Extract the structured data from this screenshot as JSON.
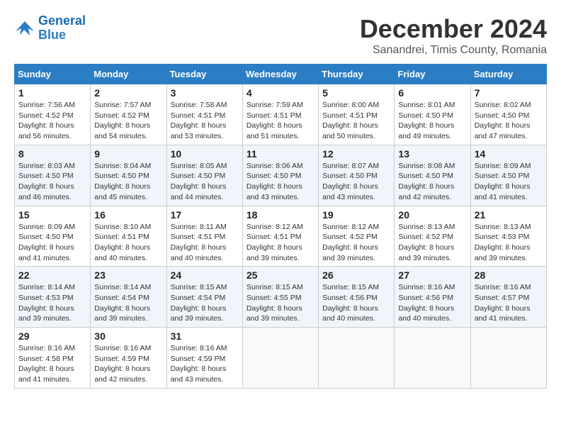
{
  "logo": {
    "line1": "General",
    "line2": "Blue"
  },
  "title": "December 2024",
  "subtitle": "Sanandrei, Timis County, Romania",
  "days_header": [
    "Sunday",
    "Monday",
    "Tuesday",
    "Wednesday",
    "Thursday",
    "Friday",
    "Saturday"
  ],
  "weeks": [
    [
      {
        "day": "1",
        "sunrise": "Sunrise: 7:56 AM",
        "sunset": "Sunset: 4:52 PM",
        "daylight": "Daylight: 8 hours and 56 minutes."
      },
      {
        "day": "2",
        "sunrise": "Sunrise: 7:57 AM",
        "sunset": "Sunset: 4:52 PM",
        "daylight": "Daylight: 8 hours and 54 minutes."
      },
      {
        "day": "3",
        "sunrise": "Sunrise: 7:58 AM",
        "sunset": "Sunset: 4:51 PM",
        "daylight": "Daylight: 8 hours and 53 minutes."
      },
      {
        "day": "4",
        "sunrise": "Sunrise: 7:59 AM",
        "sunset": "Sunset: 4:51 PM",
        "daylight": "Daylight: 8 hours and 51 minutes."
      },
      {
        "day": "5",
        "sunrise": "Sunrise: 8:00 AM",
        "sunset": "Sunset: 4:51 PM",
        "daylight": "Daylight: 8 hours and 50 minutes."
      },
      {
        "day": "6",
        "sunrise": "Sunrise: 8:01 AM",
        "sunset": "Sunset: 4:50 PM",
        "daylight": "Daylight: 8 hours and 49 minutes."
      },
      {
        "day": "7",
        "sunrise": "Sunrise: 8:02 AM",
        "sunset": "Sunset: 4:50 PM",
        "daylight": "Daylight: 8 hours and 47 minutes."
      }
    ],
    [
      {
        "day": "8",
        "sunrise": "Sunrise: 8:03 AM",
        "sunset": "Sunset: 4:50 PM",
        "daylight": "Daylight: 8 hours and 46 minutes."
      },
      {
        "day": "9",
        "sunrise": "Sunrise: 8:04 AM",
        "sunset": "Sunset: 4:50 PM",
        "daylight": "Daylight: 8 hours and 45 minutes."
      },
      {
        "day": "10",
        "sunrise": "Sunrise: 8:05 AM",
        "sunset": "Sunset: 4:50 PM",
        "daylight": "Daylight: 8 hours and 44 minutes."
      },
      {
        "day": "11",
        "sunrise": "Sunrise: 8:06 AM",
        "sunset": "Sunset: 4:50 PM",
        "daylight": "Daylight: 8 hours and 43 minutes."
      },
      {
        "day": "12",
        "sunrise": "Sunrise: 8:07 AM",
        "sunset": "Sunset: 4:50 PM",
        "daylight": "Daylight: 8 hours and 43 minutes."
      },
      {
        "day": "13",
        "sunrise": "Sunrise: 8:08 AM",
        "sunset": "Sunset: 4:50 PM",
        "daylight": "Daylight: 8 hours and 42 minutes."
      },
      {
        "day": "14",
        "sunrise": "Sunrise: 8:09 AM",
        "sunset": "Sunset: 4:50 PM",
        "daylight": "Daylight: 8 hours and 41 minutes."
      }
    ],
    [
      {
        "day": "15",
        "sunrise": "Sunrise: 8:09 AM",
        "sunset": "Sunset: 4:50 PM",
        "daylight": "Daylight: 8 hours and 41 minutes."
      },
      {
        "day": "16",
        "sunrise": "Sunrise: 8:10 AM",
        "sunset": "Sunset: 4:51 PM",
        "daylight": "Daylight: 8 hours and 40 minutes."
      },
      {
        "day": "17",
        "sunrise": "Sunrise: 8:11 AM",
        "sunset": "Sunset: 4:51 PM",
        "daylight": "Daylight: 8 hours and 40 minutes."
      },
      {
        "day": "18",
        "sunrise": "Sunrise: 8:12 AM",
        "sunset": "Sunset: 4:51 PM",
        "daylight": "Daylight: 8 hours and 39 minutes."
      },
      {
        "day": "19",
        "sunrise": "Sunrise: 8:12 AM",
        "sunset": "Sunset: 4:52 PM",
        "daylight": "Daylight: 8 hours and 39 minutes."
      },
      {
        "day": "20",
        "sunrise": "Sunrise: 8:13 AM",
        "sunset": "Sunset: 4:52 PM",
        "daylight": "Daylight: 8 hours and 39 minutes."
      },
      {
        "day": "21",
        "sunrise": "Sunrise: 8:13 AM",
        "sunset": "Sunset: 4:53 PM",
        "daylight": "Daylight: 8 hours and 39 minutes."
      }
    ],
    [
      {
        "day": "22",
        "sunrise": "Sunrise: 8:14 AM",
        "sunset": "Sunset: 4:53 PM",
        "daylight": "Daylight: 8 hours and 39 minutes."
      },
      {
        "day": "23",
        "sunrise": "Sunrise: 8:14 AM",
        "sunset": "Sunset: 4:54 PM",
        "daylight": "Daylight: 8 hours and 39 minutes."
      },
      {
        "day": "24",
        "sunrise": "Sunrise: 8:15 AM",
        "sunset": "Sunset: 4:54 PM",
        "daylight": "Daylight: 8 hours and 39 minutes."
      },
      {
        "day": "25",
        "sunrise": "Sunrise: 8:15 AM",
        "sunset": "Sunset: 4:55 PM",
        "daylight": "Daylight: 8 hours and 39 minutes."
      },
      {
        "day": "26",
        "sunrise": "Sunrise: 8:15 AM",
        "sunset": "Sunset: 4:56 PM",
        "daylight": "Daylight: 8 hours and 40 minutes."
      },
      {
        "day": "27",
        "sunrise": "Sunrise: 8:16 AM",
        "sunset": "Sunset: 4:56 PM",
        "daylight": "Daylight: 8 hours and 40 minutes."
      },
      {
        "day": "28",
        "sunrise": "Sunrise: 8:16 AM",
        "sunset": "Sunset: 4:57 PM",
        "daylight": "Daylight: 8 hours and 41 minutes."
      }
    ],
    [
      {
        "day": "29",
        "sunrise": "Sunrise: 8:16 AM",
        "sunset": "Sunset: 4:58 PM",
        "daylight": "Daylight: 8 hours and 41 minutes."
      },
      {
        "day": "30",
        "sunrise": "Sunrise: 8:16 AM",
        "sunset": "Sunset: 4:59 PM",
        "daylight": "Daylight: 8 hours and 42 minutes."
      },
      {
        "day": "31",
        "sunrise": "Sunrise: 8:16 AM",
        "sunset": "Sunset: 4:59 PM",
        "daylight": "Daylight: 8 hours and 43 minutes."
      },
      null,
      null,
      null,
      null
    ]
  ]
}
